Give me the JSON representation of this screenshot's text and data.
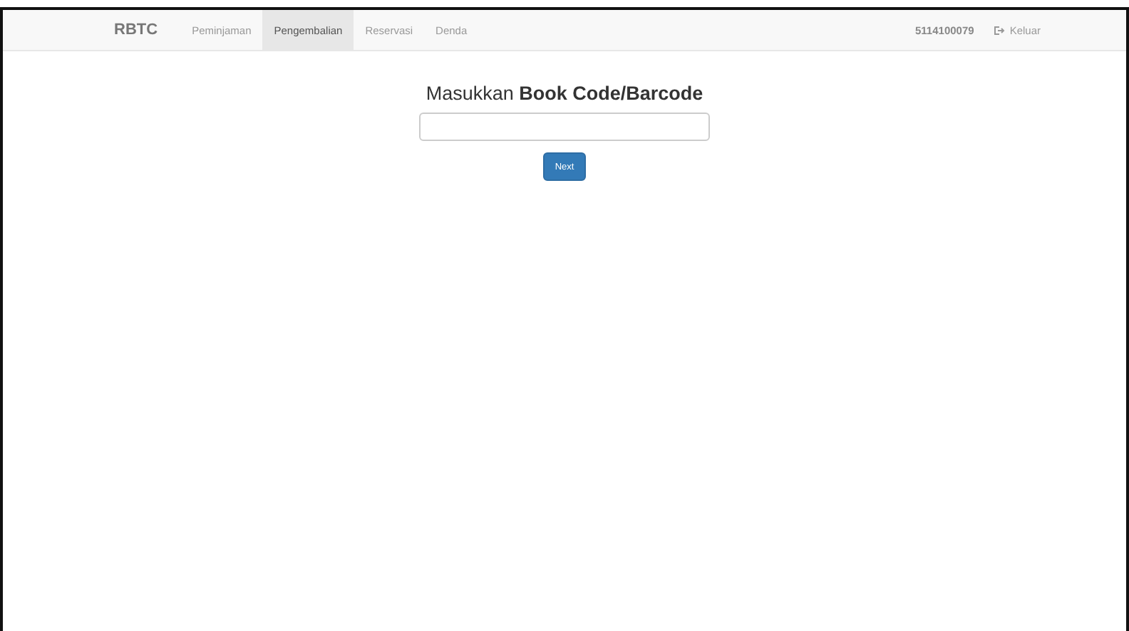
{
  "navbar": {
    "brand": "RBTC",
    "items": [
      {
        "label": "Peminjaman",
        "selected": false
      },
      {
        "label": "Pengembalian",
        "selected": true
      },
      {
        "label": "Reservasi",
        "selected": false
      },
      {
        "label": "Denda",
        "selected": false
      }
    ],
    "user": "5114100079",
    "logout": "Keluar"
  },
  "form": {
    "title": "Masukkan **Book Code/Barcode**",
    "button": "Next"
  }
}
